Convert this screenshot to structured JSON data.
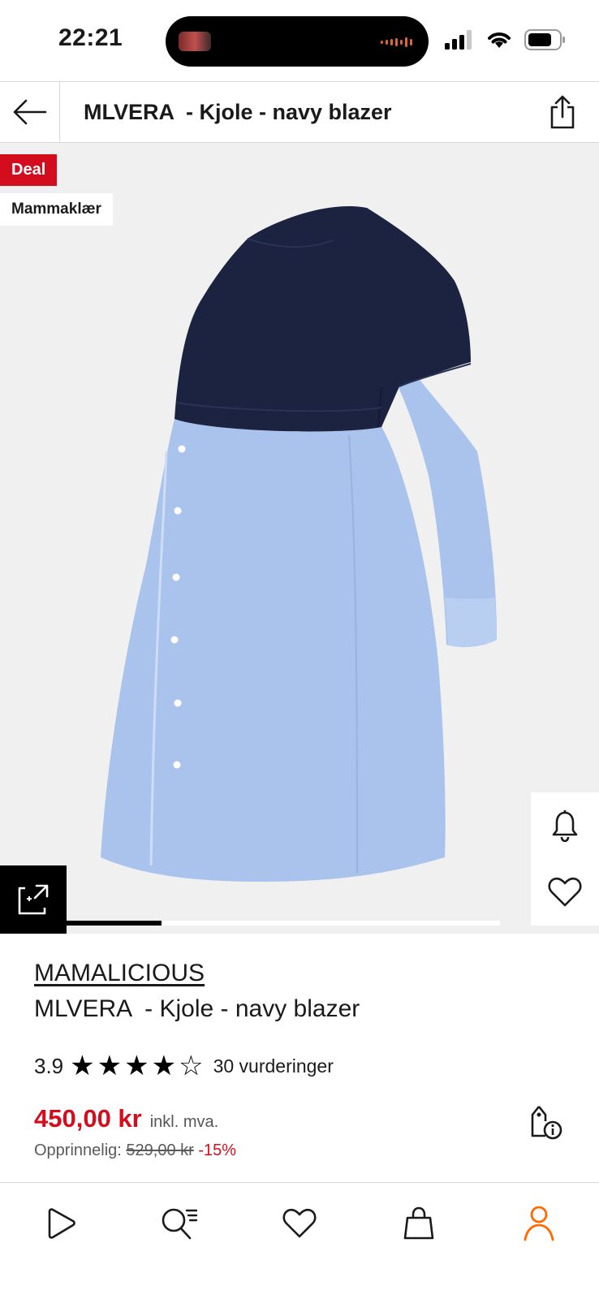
{
  "status_bar": {
    "time": "22:21"
  },
  "header": {
    "title": "MLVERA  - Kjole - navy blazer",
    "back_icon": "arrow-left-icon",
    "share_icon": "share-icon"
  },
  "gallery": {
    "badges": {
      "deal": "Deal",
      "category": "Mammaklær"
    },
    "progress_fraction": 0.22,
    "side_actions": [
      "bell-icon",
      "heart-icon"
    ],
    "zoom_icon": "zoom-expand-icon",
    "colors": {
      "background": "#f0f0f0",
      "top": "#1b2340",
      "skirt": "#aac4ec"
    }
  },
  "product": {
    "brand": "MAMALICIOUS",
    "name": "MLVERA  - Kjole - navy blazer",
    "rating": "3.9",
    "rating_stars": 4,
    "rating_max": 5,
    "reviews": "30 vurderinger",
    "price": "450,00 kr",
    "vat_note": "inkl. mva.",
    "original_label": "Opprinnelig:",
    "original_price": "529,00 kr",
    "discount": "-15%",
    "price_info_icon": "price-tag-info-icon"
  },
  "bottom_nav": {
    "items": [
      "play-icon",
      "search-list-icon",
      "heart-icon",
      "bag-icon",
      "profile-icon"
    ],
    "active": "profile-icon",
    "active_color": "#ff6900"
  },
  "colors": {
    "accent_red": "#d30c1e",
    "accent_orange": "#ff6900"
  }
}
